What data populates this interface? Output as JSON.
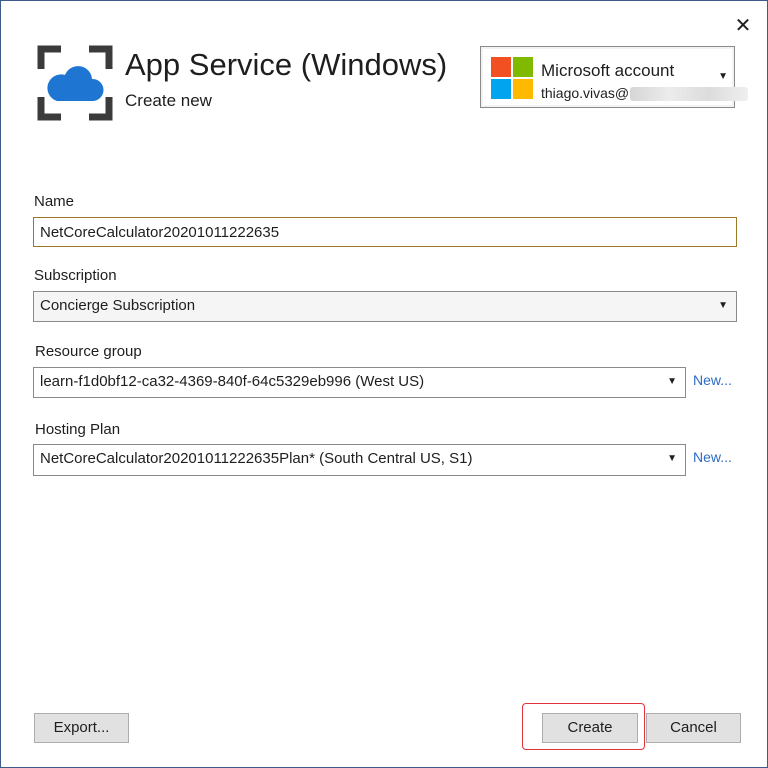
{
  "window": {
    "close_glyph": "✕"
  },
  "header": {
    "title": "App Service (Windows)",
    "subtitle": "Create new",
    "icon": "azure-app-service-icon"
  },
  "account": {
    "name": "Microsoft account",
    "email_visible": "thiago.vivas@",
    "logo_colors": [
      "#f25022",
      "#7fba00",
      "#00a4ef",
      "#ffb900"
    ]
  },
  "form": {
    "name": {
      "label": "Name",
      "value": "NetCoreCalculator20201011222635"
    },
    "subscription": {
      "label": "Subscription",
      "value": "Concierge Subscription"
    },
    "resource_group": {
      "label": "Resource group",
      "value": "learn-f1d0bf12-ca32-4369-840f-64c5329eb996 (West US)",
      "new_link": "New..."
    },
    "hosting_plan": {
      "label": "Hosting Plan",
      "value": "NetCoreCalculator20201011222635Plan* (South Central US, S1)",
      "new_link": "New..."
    }
  },
  "footer": {
    "export_label": "Export...",
    "create_label": "Create",
    "cancel_label": "Cancel"
  },
  "colors": {
    "accent_link": "#2b6cc4",
    "name_field_border": "#9c7a25",
    "highlight_ring": "#e0343d"
  }
}
